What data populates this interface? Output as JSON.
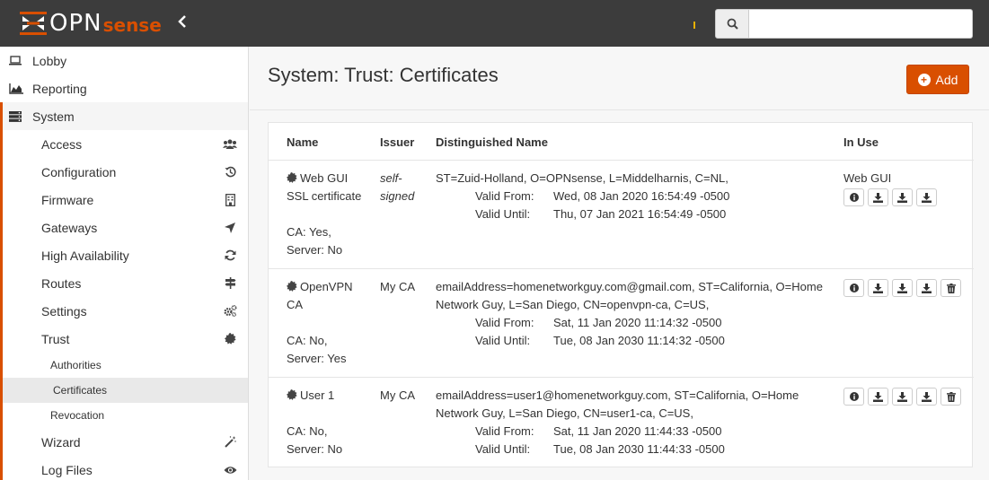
{
  "header": {
    "logo_text": "OPN",
    "logo_text2": "sense",
    "collapse_icon": "chevron-left-icon",
    "search_placeholder": ""
  },
  "sidebar": {
    "top_items": [
      {
        "label": "Lobby",
        "icon": "laptop-icon"
      },
      {
        "label": "Reporting",
        "icon": "area-chart-icon"
      },
      {
        "label": "System",
        "icon": "server-icon"
      }
    ],
    "system_items": [
      {
        "label": "Access",
        "icon": "users-icon"
      },
      {
        "label": "Configuration",
        "icon": "history-icon"
      },
      {
        "label": "Firmware",
        "icon": "building-icon"
      },
      {
        "label": "Gateways",
        "icon": "location-arrow-icon"
      },
      {
        "label": "High Availability",
        "icon": "refresh-icon"
      },
      {
        "label": "Routes",
        "icon": "map-signs-icon"
      },
      {
        "label": "Settings",
        "icon": "cogs-icon"
      },
      {
        "label": "Trust",
        "icon": "certificate-icon"
      }
    ],
    "trust_items": [
      "Authorities",
      "Certificates",
      "Revocation"
    ],
    "bottom_items": [
      {
        "label": "Wizard",
        "icon": "magic-icon"
      },
      {
        "label": "Log Files",
        "icon": "eye-icon"
      }
    ]
  },
  "page": {
    "title": "System: Trust: Certificates",
    "add_label": "Add"
  },
  "table": {
    "columns": [
      "Name",
      "Issuer",
      "Distinguished Name",
      "In Use"
    ],
    "rows": [
      {
        "name_l1": "Web GUI",
        "name_l2": "SSL certificate",
        "flags_l1": "CA: Yes,",
        "flags_l2": "Server: No",
        "issuer_l1": "self-",
        "issuer_l2": "signed",
        "dn_l1": "ST=Zuid-Holland, O=OPNsense, L=Middelharnis, C=NL,",
        "dn_l2": "",
        "valid_from_label": "Valid From:",
        "valid_from": "Wed, 08 Jan 2020 16:54:49 -0500",
        "valid_until_label": "Valid Until:",
        "valid_until": "Thu, 07 Jan 2021 16:54:49 -0500",
        "in_use": "Web GUI"
      },
      {
        "name_l1": "OpenVPN",
        "name_l2": "CA",
        "flags_l1": "CA: No,",
        "flags_l2": "Server: Yes",
        "issuer": "My CA",
        "dn_l1": "emailAddress=homenetworkguy.com@gmail.com, ST=California, O=Home",
        "dn_l2": "Network Guy, L=San Diego, CN=openvpn-ca, C=US,",
        "valid_from_label": "Valid From:",
        "valid_from": "Sat, 11 Jan 2020 11:14:32 -0500",
        "valid_until_label": "Valid Until:",
        "valid_until": "Tue, 08 Jan 2030 11:14:32 -0500",
        "in_use": ""
      },
      {
        "name_l1": "User 1",
        "flags_l1": "CA: No,",
        "flags_l2": "Server: No",
        "issuer": "My CA",
        "dn_l1": "emailAddress=user1@homenetworkguy.com, ST=California, O=Home",
        "dn_l2": "Network Guy, L=San Diego, CN=user1-ca, C=US,",
        "valid_from_label": "Valid From:",
        "valid_from": "Sat, 11 Jan 2020 11:44:33 -0500",
        "valid_until_label": "Valid Until:",
        "valid_until": "Tue, 08 Jan 2030 11:44:33 -0500",
        "in_use": ""
      }
    ],
    "action_icons": [
      "info-icon",
      "download-icon",
      "download-icon",
      "download-icon",
      "trash-icon"
    ]
  },
  "colors": {
    "accent": "#d94f00",
    "topbar": "#3c3c3c"
  }
}
